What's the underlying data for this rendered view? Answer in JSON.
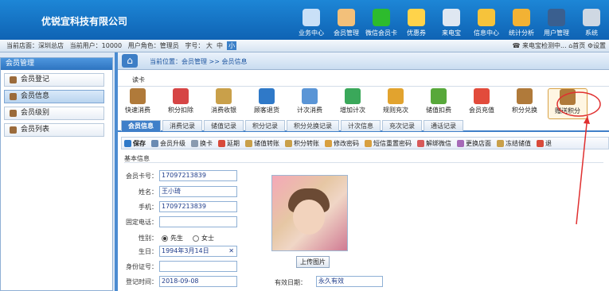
{
  "app": {
    "title": "优锐宜科技有限公司"
  },
  "nav": [
    {
      "label": "业务中心",
      "icon": "business-icon",
      "color": "#c9e0f7"
    },
    {
      "label": "会员管理",
      "icon": "member-icon",
      "color": "#f3c07a"
    },
    {
      "label": "微信会员卡",
      "icon": "wechat-icon",
      "color": "#2dbb2d"
    },
    {
      "label": "优惠券",
      "icon": "coupon-icon",
      "color": "#ffd34a"
    },
    {
      "label": "来电宝",
      "icon": "phone-icon",
      "color": "#dfe7f1"
    },
    {
      "label": "信息中心",
      "icon": "message-icon",
      "color": "#f6c33b"
    },
    {
      "label": "统计分析",
      "icon": "chart-icon",
      "color": "#f2b234"
    },
    {
      "label": "用户管理",
      "icon": "user-icon",
      "color": "#3a5f8f"
    },
    {
      "label": "系统",
      "icon": "settings-icon",
      "color": "#cfd8e3"
    }
  ],
  "info": {
    "store_label": "当前店面：深圳总店",
    "user_label": "当前用户：10000",
    "role_label": "用户角色：管理员",
    "font_label": "字号：",
    "font_large": "大",
    "font_medium": "中",
    "font_small": "小",
    "phone_detect": "来电宝检测中...",
    "home": "首页",
    "settings": "设置"
  },
  "sidebar": {
    "title": "会员管理",
    "items": [
      {
        "label": "会员登记"
      },
      {
        "label": "会员信息"
      },
      {
        "label": "会员级别"
      },
      {
        "label": "会员列表"
      }
    ]
  },
  "breadcrumb": "当前位置：会员管理 >> 会员信息",
  "readcard": "读卡",
  "toolbar": [
    {
      "label": "快速消费",
      "icon": "quick-consume-icon",
      "color": "#b07a3a"
    },
    {
      "label": "积分扣除",
      "icon": "points-deduct-icon",
      "color": "#d64545"
    },
    {
      "label": "消费收银",
      "icon": "cashier-icon",
      "color": "#c9a04a"
    },
    {
      "label": "顾客退货",
      "icon": "return-icon",
      "color": "#2f79c8"
    },
    {
      "label": "计次消费",
      "icon": "count-consume-icon",
      "color": "#5a95d6"
    },
    {
      "label": "增加计次",
      "icon": "add-count-icon",
      "color": "#3aa85a"
    },
    {
      "label": "规则充次",
      "icon": "rule-recharge-icon",
      "color": "#e2a32e"
    },
    {
      "label": "储值扣费",
      "icon": "stored-deduct-icon",
      "color": "#58a83a"
    },
    {
      "label": "会员充值",
      "icon": "member-recharge-icon",
      "color": "#e24b3b"
    },
    {
      "label": "积分兑换",
      "icon": "points-exchange-icon",
      "color": "#b07a3a"
    },
    {
      "label": "赠送积分",
      "icon": "gift-points-icon",
      "color": "#b07a3a"
    }
  ],
  "tabs": [
    {
      "label": "会员信息"
    },
    {
      "label": "消费记录"
    },
    {
      "label": "储值记录"
    },
    {
      "label": "积分记录"
    },
    {
      "label": "积分兑换记录"
    },
    {
      "label": "计次信息"
    },
    {
      "label": "充次记录"
    },
    {
      "label": "通话记录"
    }
  ],
  "actions": [
    {
      "label": "保存",
      "icon": "save-icon",
      "color": "#2f79c8"
    },
    {
      "label": "会员升级",
      "icon": "upgrade-icon",
      "color": "#6a8bb3"
    },
    {
      "label": "换卡",
      "icon": "change-card-icon",
      "color": "#8a9bb0"
    },
    {
      "label": "延期",
      "icon": "extend-icon",
      "color": "#d84a3a"
    },
    {
      "label": "储值转账",
      "icon": "transfer-icon",
      "color": "#c9a04a"
    },
    {
      "label": "积分转账",
      "icon": "points-transfer-icon",
      "color": "#c9a04a"
    },
    {
      "label": "修改密码",
      "icon": "password-icon",
      "color": "#d8a040"
    },
    {
      "label": "短信重置密码",
      "icon": "sms-reset-icon",
      "color": "#d8a040"
    },
    {
      "label": "解绑微信",
      "icon": "unbind-wechat-icon",
      "color": "#d85a5a"
    },
    {
      "label": "更换店面",
      "icon": "change-store-icon",
      "color": "#a66ab8"
    },
    {
      "label": "冻结储值",
      "icon": "freeze-icon",
      "color": "#c9a04a"
    },
    {
      "label": "退",
      "icon": "refund-icon",
      "color": "#d84a3a"
    }
  ],
  "form": {
    "section": "基本信息",
    "card_label": "会员卡号：",
    "card_value": "17097213839",
    "name_label": "姓名：",
    "name_value": "王小琦",
    "mobile_label": "手机：",
    "mobile_value": "17097213839",
    "phone_label": "固定电话：",
    "phone_value": "",
    "gender_label": "性别：",
    "gender_male": "先生",
    "gender_female": "女士",
    "birthday_label": "生日：",
    "birthday_value": "1994年3月14日",
    "id_label": "身份证号：",
    "id_value": "",
    "reg_label": "登记时间：",
    "reg_value": "2018-09-08",
    "valid_label": "有效日期：",
    "valid_value": "永久有效",
    "upload_label": "上传图片"
  },
  "annotation_color": "#e03030"
}
